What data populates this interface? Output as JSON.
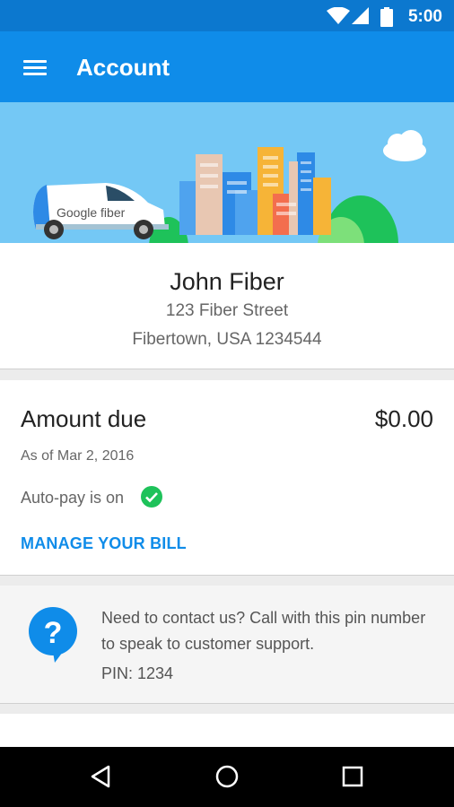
{
  "status_bar": {
    "time": "5:00",
    "icons": [
      "wifi-icon",
      "signal-icon",
      "battery-icon"
    ]
  },
  "app_bar": {
    "title": "Account",
    "menu_icon": "menu-icon"
  },
  "hero": {
    "van_text": "Google fiber"
  },
  "profile": {
    "name": "John Fiber",
    "address_line1": "123 Fiber Street",
    "address_line2": "Fibertown, USA 1234544"
  },
  "bill": {
    "label": "Amount due",
    "amount": "$0.00",
    "as_of": "As of Mar 2, 2016",
    "autopay": "Auto-pay is on",
    "manage_label": "MANAGE YOUR BILL"
  },
  "support": {
    "message": "Need to contact us? Call with this pin number to speak to customer support.",
    "pin": "PIN: 1234"
  },
  "nav": {
    "icons": [
      "back-icon",
      "home-icon",
      "recents-icon"
    ]
  },
  "colors": {
    "status_bar": "#0c78cf",
    "app_bar": "#0f8ce9",
    "hero_sky": "#74c8f5",
    "accent": "#0f8ce9",
    "check": "#1ec25a"
  }
}
